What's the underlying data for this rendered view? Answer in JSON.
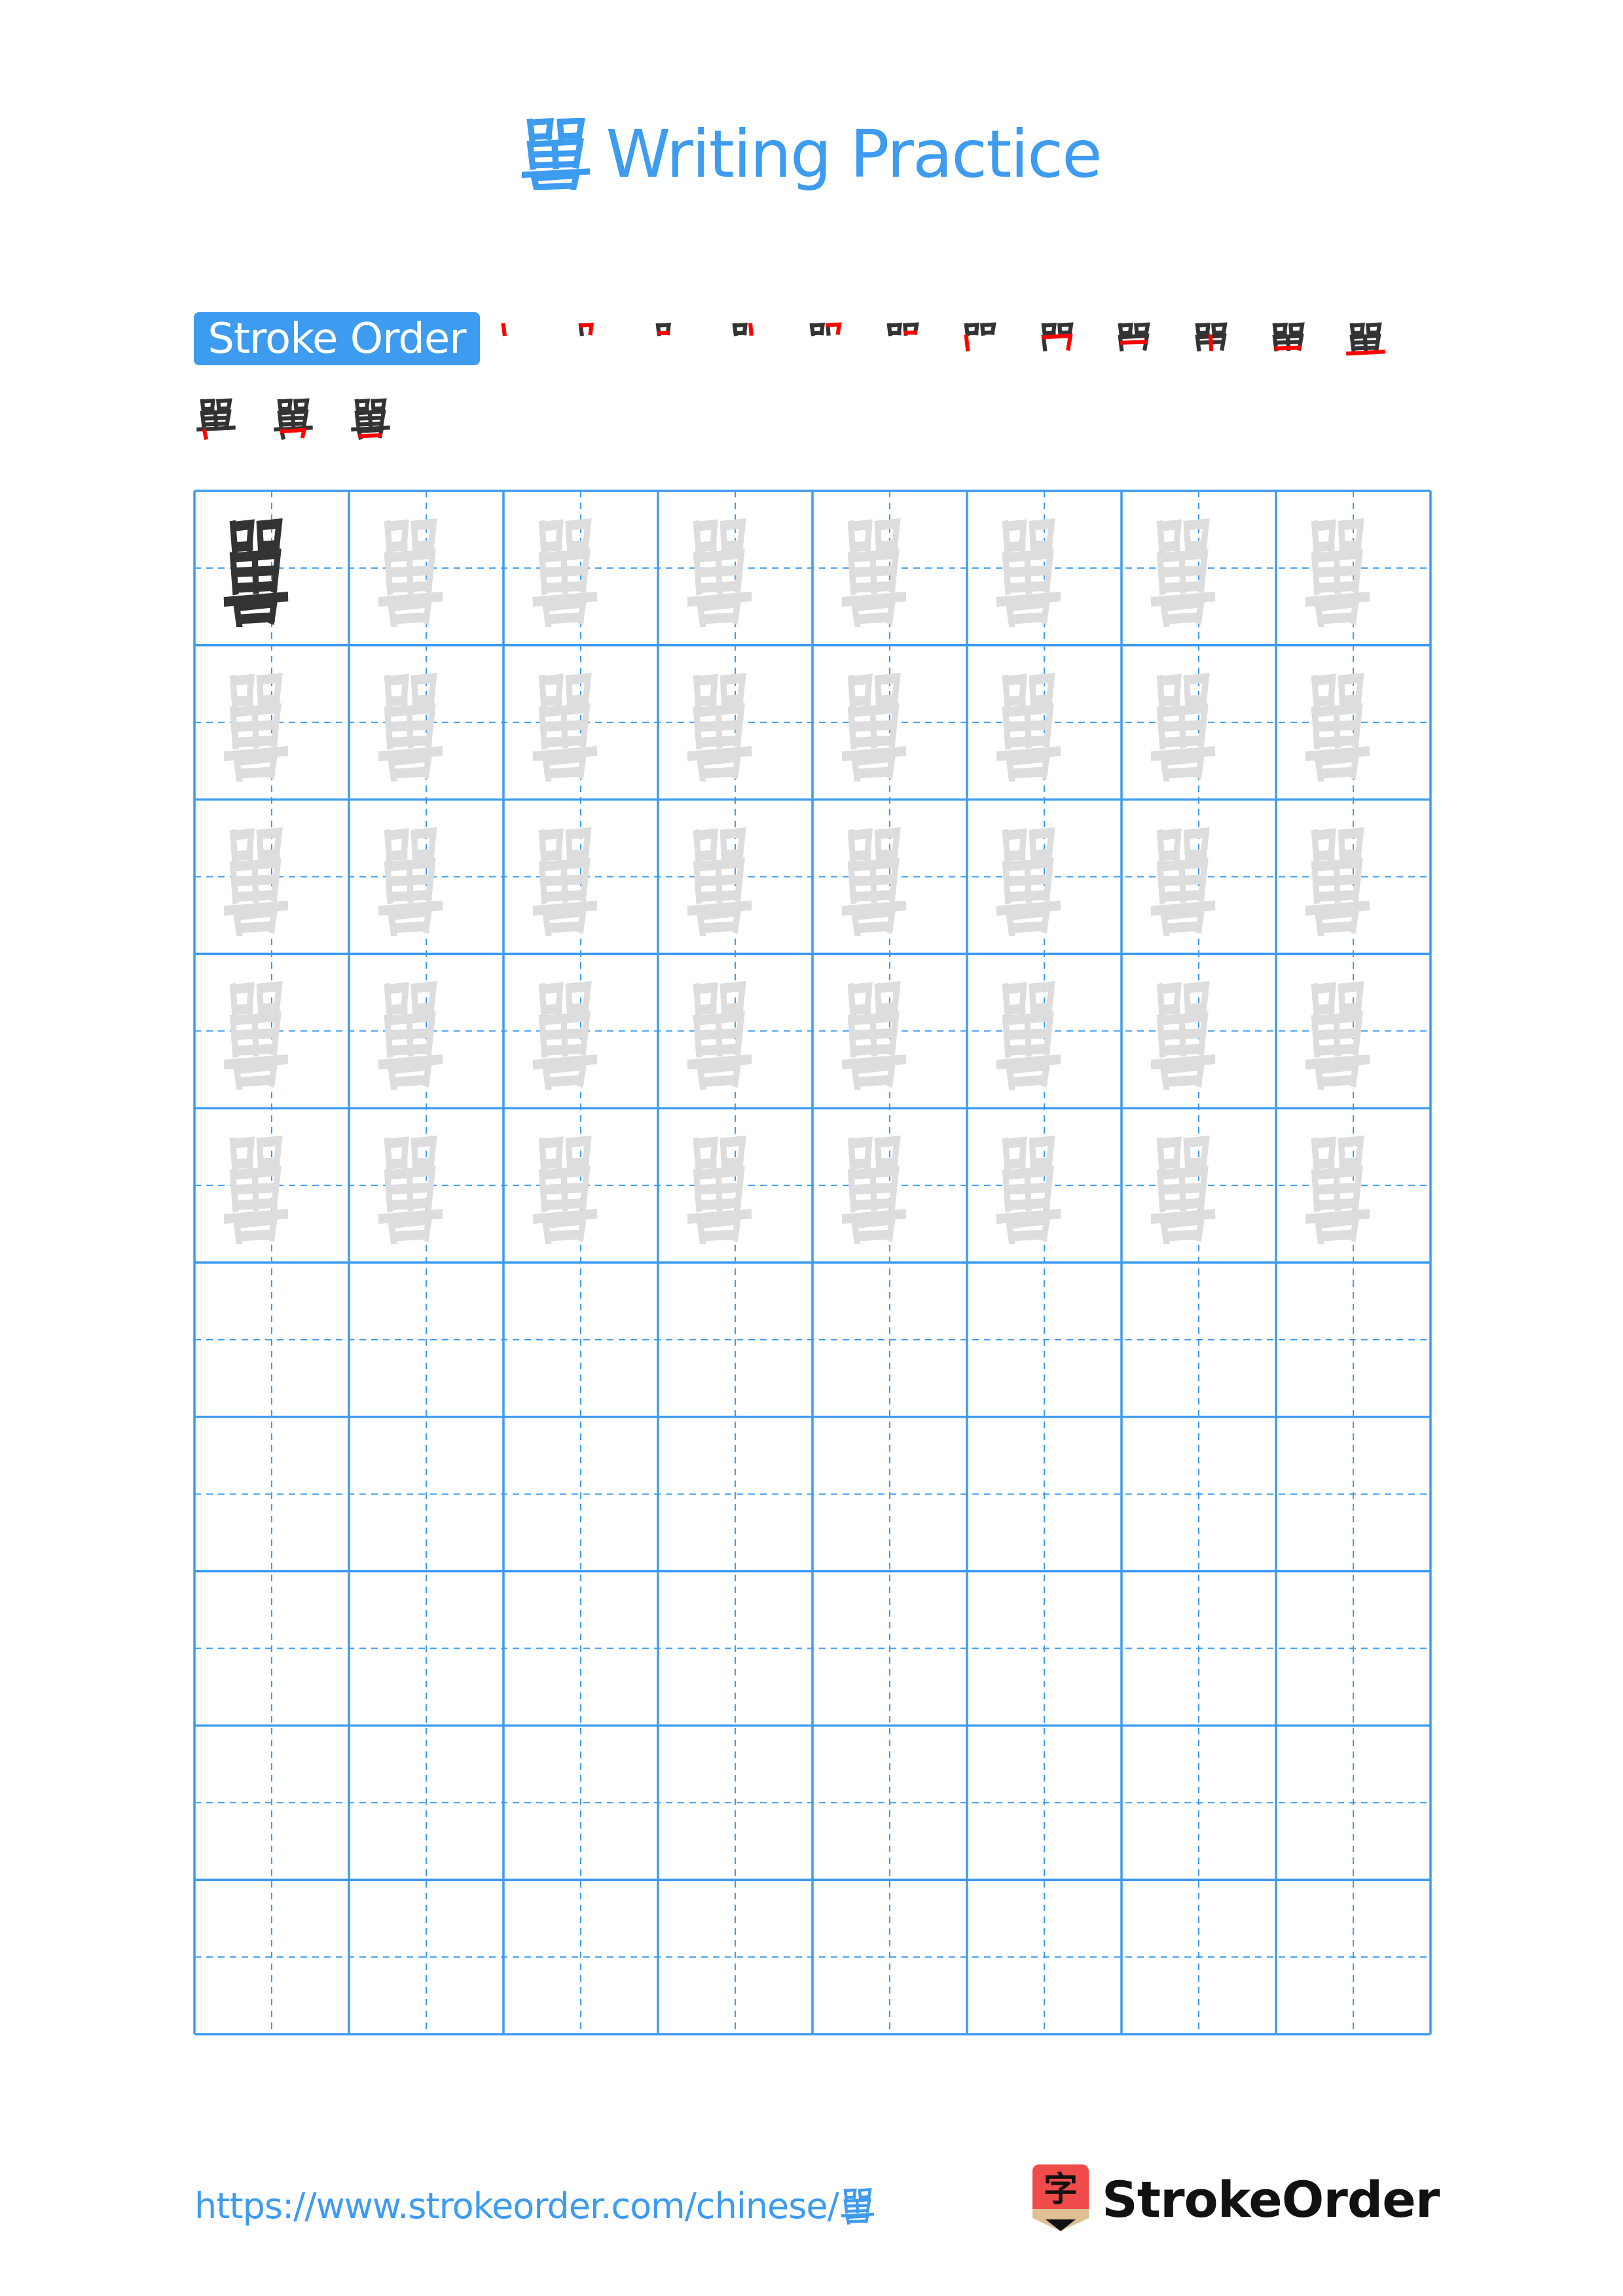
{
  "page": {
    "character": "嘼",
    "title_suffix": "Writing Practice",
    "stroke_order_label": "Stroke Order",
    "stroke_count": 15,
    "footer_url": "https://www.strokeorder.com/chinese/",
    "footer_url_char": "嘼",
    "brand_name": "StrokeOrder",
    "brand_icon_char": "字"
  },
  "colors": {
    "accent": "#3d9bf0",
    "model_char": "#333333",
    "trace_char": "#dddddd",
    "stroke_highlight": "#ff0000",
    "logo_red": "#f04b4b",
    "logo_tan": "#e0bf94"
  },
  "grid": {
    "rows": 10,
    "cols": 8,
    "model_cells": 1,
    "trace_rows": 5,
    "empty_rows": 5
  }
}
